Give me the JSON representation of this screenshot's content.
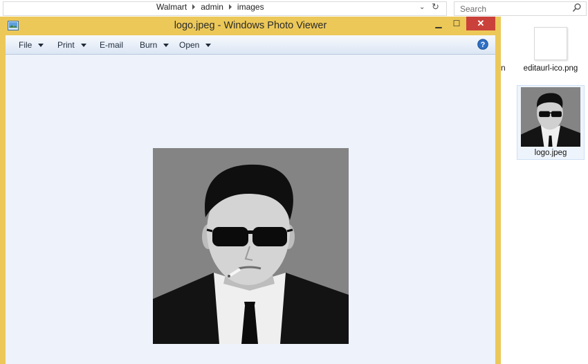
{
  "explorer": {
    "breadcrumb": [
      "Walmart",
      "admin",
      "images"
    ],
    "search": {
      "placeholder": "Search"
    },
    "partial_label": "n",
    "files": [
      {
        "name": "editaurl-ico.png",
        "icon": "blank-image-thumbnail"
      },
      {
        "name": "logo.jpeg",
        "icon": "photo-thumbnail",
        "selected": true
      }
    ],
    "icons": {
      "dropdown": "chevron-down-icon",
      "refresh": "refresh-icon",
      "search": "search-icon"
    }
  },
  "viewer": {
    "title": "logo.jpeg - Windows Photo Viewer",
    "window_buttons": {
      "minimize": "▁",
      "maximize": "☐",
      "close": "✕"
    },
    "menu": [
      {
        "label": "File",
        "has_dropdown": true
      },
      {
        "label": "Print",
        "has_dropdown": true
      },
      {
        "label": "E-mail",
        "has_dropdown": false
      },
      {
        "label": "Burn",
        "has_dropdown": true
      },
      {
        "label": "Open",
        "has_dropdown": true
      }
    ],
    "icons": {
      "app": "photo-viewer-app-icon",
      "help": "help-icon"
    }
  },
  "colors": {
    "title_bar": "#ecc858",
    "close_button": "#c9413a",
    "viewer_background": "#eef2fa",
    "photo_background": "#848484"
  }
}
